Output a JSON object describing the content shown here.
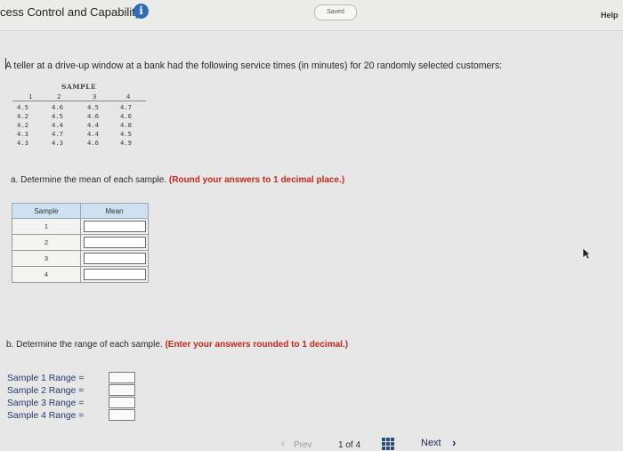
{
  "header": {
    "title": "cess Control and Capability",
    "saved_label": "Saved",
    "help_label": "Help",
    "info_icon": "info-icon"
  },
  "problem": {
    "prompt": "A teller at a drive-up window at a bank had the following service times (in minutes) for 20 randomly selected customers:"
  },
  "sample_table": {
    "header": "SAMPLE",
    "columns": [
      "1",
      "2",
      "3",
      "4"
    ],
    "rows": [
      [
        "4.5",
        "4.6",
        "4.5",
        "4.7"
      ],
      [
        "4.2",
        "4.5",
        "4.6",
        "4.6"
      ],
      [
        "4.2",
        "4.4",
        "4.4",
        "4.8"
      ],
      [
        "4.3",
        "4.7",
        "4.4",
        "4.5"
      ],
      [
        "4.3",
        "4.3",
        "4.6",
        "4.9"
      ]
    ]
  },
  "part_a": {
    "prefix": "a. Determine the mean of each sample.",
    "instruction": "(Round your answers to 1 decimal place.)",
    "col_sample": "Sample",
    "col_mean": "Mean",
    "samples": [
      "1",
      "2",
      "3",
      "4"
    ]
  },
  "part_b": {
    "prefix": "b. Determine the range of each sample.",
    "instruction": "(Enter your answers rounded to 1 decimal.)",
    "rows": [
      {
        "label": "Sample 1 Range =",
        "value": ""
      },
      {
        "label": "Sample 2 Range =",
        "value": ""
      },
      {
        "label": "Sample 3 Range =",
        "value": ""
      },
      {
        "label": "Sample 4 Range =",
        "value": ""
      }
    ]
  },
  "footer": {
    "prev_label": "Prev",
    "page_label": "1 of 4",
    "next_label": "Next"
  }
}
